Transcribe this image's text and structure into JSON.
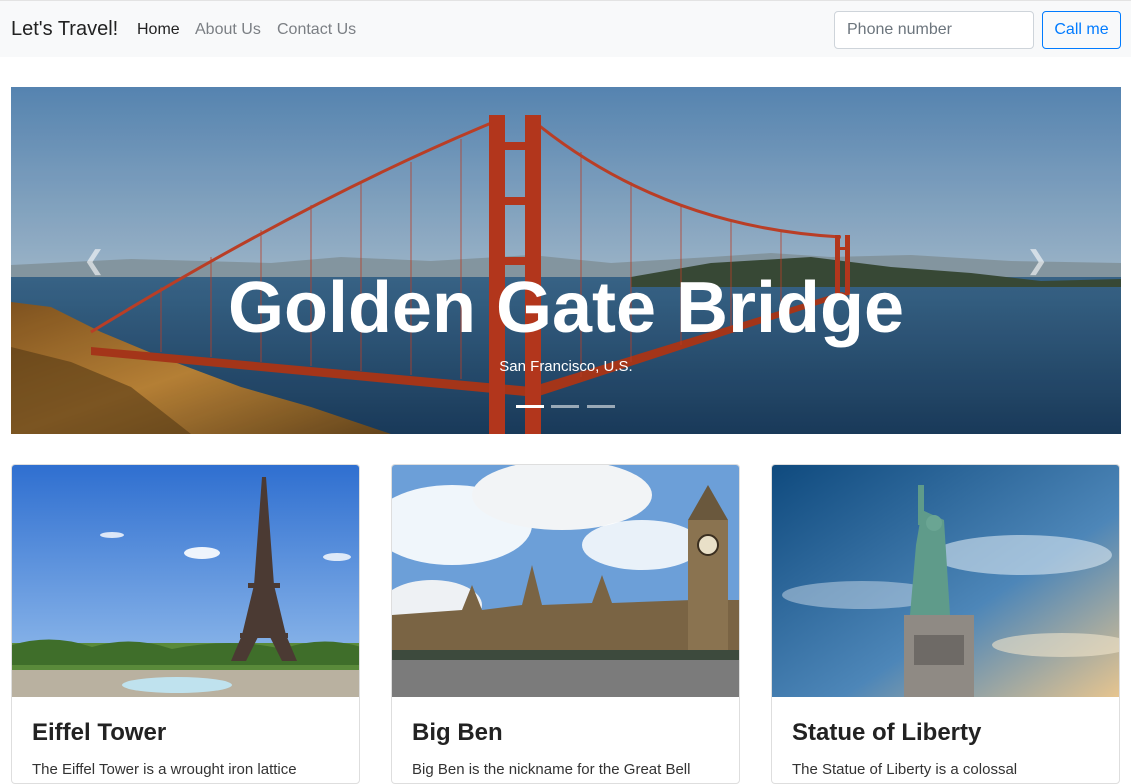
{
  "navbar": {
    "brand": "Let's Travel!",
    "links": [
      {
        "label": "Home"
      },
      {
        "label": "About Us"
      },
      {
        "label": "Contact Us"
      }
    ],
    "phone_placeholder": "Phone number",
    "call_label": "Call me"
  },
  "carousel": {
    "title": "Golden Gate Bridge",
    "subtitle": "San Francisco, U.S.",
    "prev_icon": "chevron-left-icon",
    "next_icon": "chevron-right-icon",
    "indicators": 3,
    "active_indicator": 1
  },
  "cards": [
    {
      "title": "Eiffel Tower",
      "text": "The Eiffel Tower is a wrought iron lattice"
    },
    {
      "title": "Big Ben",
      "text": "Big Ben is the nickname for the Great Bell"
    },
    {
      "title": "Statue of Liberty",
      "text": "The Statue of Liberty is a colossal"
    }
  ]
}
